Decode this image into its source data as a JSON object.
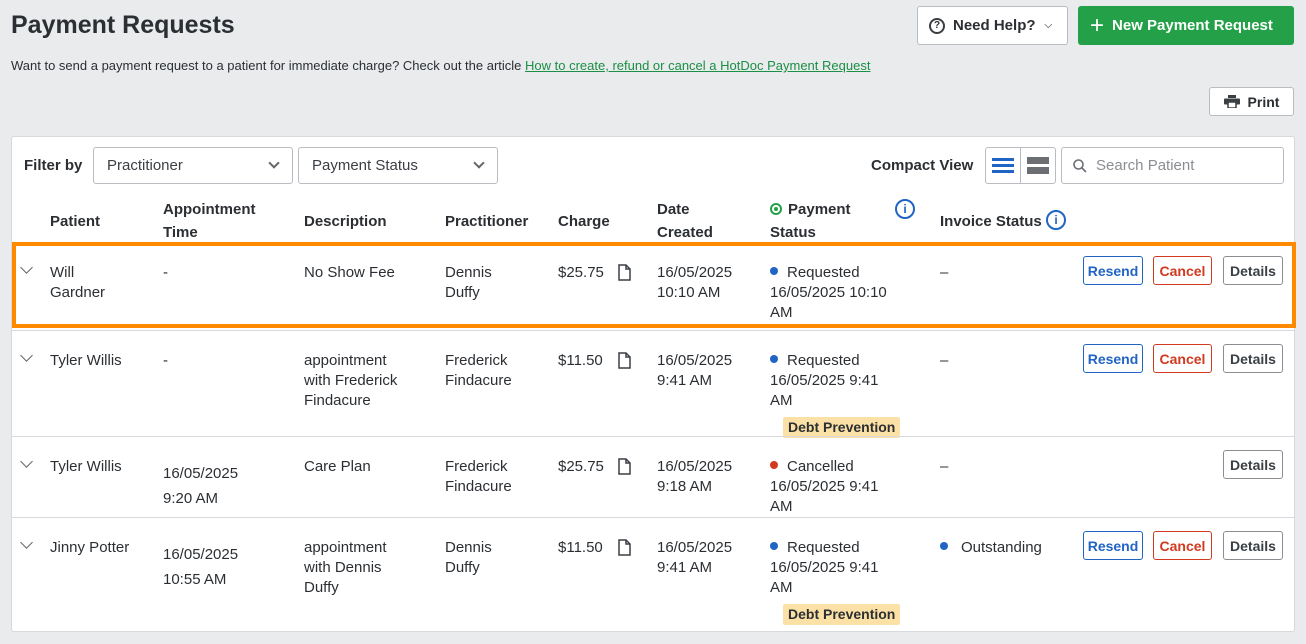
{
  "header": {
    "title": "Payment Requests",
    "help_label": "Need Help?",
    "new_label": "New Payment Request",
    "intro_text": "Want to send a payment request to a patient for immediate charge? Check out the article ",
    "intro_link": "How to create, refund or cancel a HotDoc Payment Request",
    "print_label": "Print"
  },
  "filters": {
    "label": "Filter by",
    "practitioner": "Practitioner",
    "payment_status": "Payment Status",
    "compact_label": "Compact View",
    "search_placeholder": "Search Patient"
  },
  "columns": {
    "patient": "Patient",
    "appointment_time": "Appointment Time",
    "description": "Description",
    "practitioner": "Practitioner",
    "charge": "Charge",
    "date_created": "Date Created",
    "payment_status": "Payment Status",
    "invoice_status": "Invoice Status"
  },
  "actions": {
    "resend": "Resend",
    "cancel": "Cancel",
    "details": "Details"
  },
  "rows": [
    {
      "patient": [
        "Will",
        "Gardner"
      ],
      "appointment_time": [
        "-"
      ],
      "description": [
        "No Show Fee"
      ],
      "practitioner": [
        "Dennis",
        "Duffy"
      ],
      "charge": "$25.75",
      "date_created": [
        "16/05/2025",
        "10:10 AM"
      ],
      "status": "Requested",
      "status_color": "#2064c4",
      "status_date": [
        "16/05/2025 10:10",
        "AM"
      ],
      "badge": "",
      "invoice": "–",
      "buttons": [
        "resend",
        "cancel",
        "details"
      ]
    },
    {
      "patient": [
        "Tyler Willis"
      ],
      "appointment_time": [
        "-"
      ],
      "description": [
        "appointment",
        "with Frederick",
        "Findacure"
      ],
      "practitioner": [
        "Frederick",
        "Findacure"
      ],
      "charge": "$11.50",
      "date_created": [
        "16/05/2025",
        "9:41 AM"
      ],
      "status": "Requested",
      "status_color": "#2064c4",
      "status_date": [
        "16/05/2025 9:41",
        "AM"
      ],
      "badge": "Debt Prevention",
      "invoice": "–",
      "buttons": [
        "resend",
        "cancel",
        "details"
      ]
    },
    {
      "patient": [
        "Tyler Willis"
      ],
      "appointment_time": [
        "16/05/2025",
        "9:20 AM"
      ],
      "description": [
        "Care Plan"
      ],
      "practitioner": [
        "Frederick",
        "Findacure"
      ],
      "charge": "$25.75",
      "date_created": [
        "16/05/2025",
        "9:18 AM"
      ],
      "status": "Cancelled",
      "status_color": "#d23a1f",
      "status_date": [
        "16/05/2025 9:41",
        "AM"
      ],
      "badge": "",
      "invoice": "–",
      "buttons": [
        "details"
      ]
    },
    {
      "patient": [
        "Jinny Potter"
      ],
      "appointment_time": [
        "16/05/2025",
        "10:55 AM"
      ],
      "description": [
        "appointment",
        "with Dennis",
        "Duffy"
      ],
      "practitioner": [
        "Dennis",
        "Duffy"
      ],
      "charge": "$11.50",
      "date_created": [
        "16/05/2025",
        "9:41 AM"
      ],
      "status": "Requested",
      "status_color": "#2064c4",
      "status_date": [
        "16/05/2025 9:41",
        "AM"
      ],
      "badge": "Debt Prevention",
      "invoice": "Outstanding",
      "invoice_color": "#2064c4",
      "buttons": [
        "resend",
        "cancel",
        "details"
      ]
    }
  ]
}
